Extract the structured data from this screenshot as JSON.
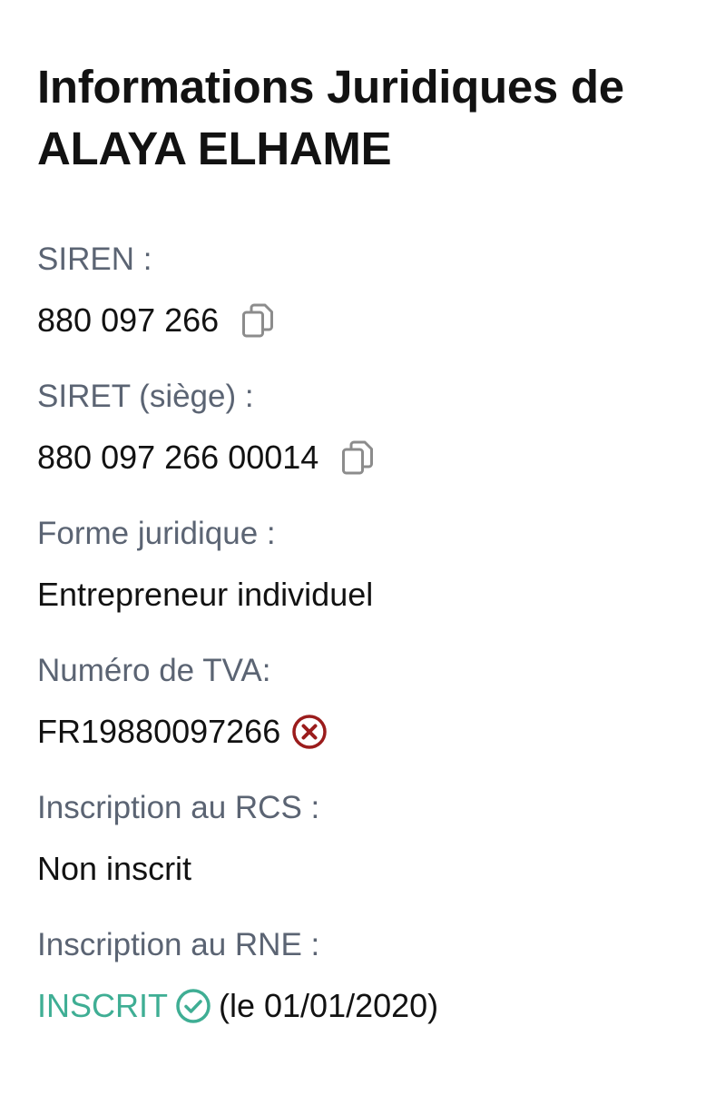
{
  "heading": {
    "line1": "Informations Juridiques de",
    "line2": "ALAYA ELHAME"
  },
  "colors": {
    "label": "#5b6473",
    "value": "#121212",
    "copy_icon": "#8c8c8c",
    "error": "#9b1c1c",
    "success": "#3fae94"
  },
  "fields": {
    "siren": {
      "label": "SIREN :",
      "value": "880 097 266",
      "action_icon": "copy-icon"
    },
    "siret": {
      "label": "SIRET (siège) :",
      "value": "880 097 266 00014",
      "action_icon": "copy-icon"
    },
    "forme": {
      "label": "Forme juridique :",
      "value": "Entrepreneur individuel"
    },
    "tva": {
      "label": "Numéro de TVA:",
      "value": "FR19880097266",
      "status_icon": "error-circle-x-icon"
    },
    "rcs": {
      "label": "Inscription au RCS :",
      "value": "Non inscrit"
    },
    "rne": {
      "label": "Inscription au RNE :",
      "status": "INSCRIT",
      "status_icon": "check-circle-icon",
      "date": "(le 01/01/2020)"
    }
  }
}
